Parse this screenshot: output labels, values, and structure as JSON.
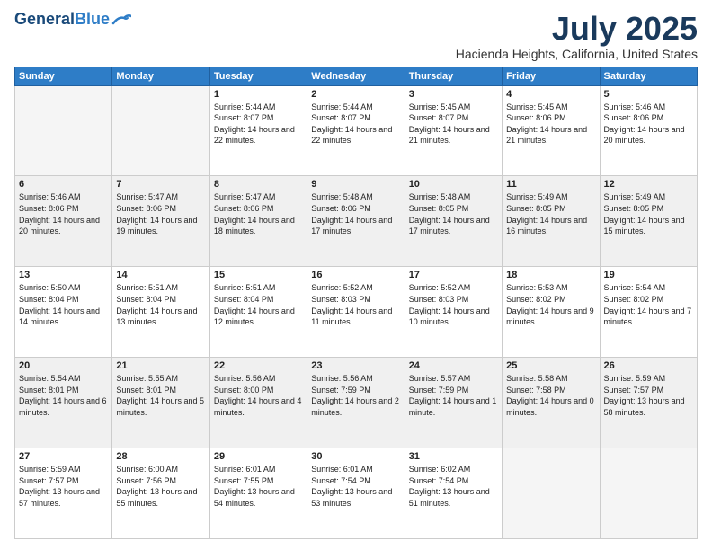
{
  "header": {
    "logo_line1": "General",
    "logo_line2": "Blue",
    "month_title": "July 2025",
    "location": "Hacienda Heights, California, United States"
  },
  "weekdays": [
    "Sunday",
    "Monday",
    "Tuesday",
    "Wednesday",
    "Thursday",
    "Friday",
    "Saturday"
  ],
  "weeks": [
    [
      {
        "day": "",
        "info": ""
      },
      {
        "day": "",
        "info": ""
      },
      {
        "day": "1",
        "info": "Sunrise: 5:44 AM\nSunset: 8:07 PM\nDaylight: 14 hours and 22 minutes."
      },
      {
        "day": "2",
        "info": "Sunrise: 5:44 AM\nSunset: 8:07 PM\nDaylight: 14 hours and 22 minutes."
      },
      {
        "day": "3",
        "info": "Sunrise: 5:45 AM\nSunset: 8:07 PM\nDaylight: 14 hours and 21 minutes."
      },
      {
        "day": "4",
        "info": "Sunrise: 5:45 AM\nSunset: 8:06 PM\nDaylight: 14 hours and 21 minutes."
      },
      {
        "day": "5",
        "info": "Sunrise: 5:46 AM\nSunset: 8:06 PM\nDaylight: 14 hours and 20 minutes."
      }
    ],
    [
      {
        "day": "6",
        "info": "Sunrise: 5:46 AM\nSunset: 8:06 PM\nDaylight: 14 hours and 20 minutes."
      },
      {
        "day": "7",
        "info": "Sunrise: 5:47 AM\nSunset: 8:06 PM\nDaylight: 14 hours and 19 minutes."
      },
      {
        "day": "8",
        "info": "Sunrise: 5:47 AM\nSunset: 8:06 PM\nDaylight: 14 hours and 18 minutes."
      },
      {
        "day": "9",
        "info": "Sunrise: 5:48 AM\nSunset: 8:06 PM\nDaylight: 14 hours and 17 minutes."
      },
      {
        "day": "10",
        "info": "Sunrise: 5:48 AM\nSunset: 8:05 PM\nDaylight: 14 hours and 17 minutes."
      },
      {
        "day": "11",
        "info": "Sunrise: 5:49 AM\nSunset: 8:05 PM\nDaylight: 14 hours and 16 minutes."
      },
      {
        "day": "12",
        "info": "Sunrise: 5:49 AM\nSunset: 8:05 PM\nDaylight: 14 hours and 15 minutes."
      }
    ],
    [
      {
        "day": "13",
        "info": "Sunrise: 5:50 AM\nSunset: 8:04 PM\nDaylight: 14 hours and 14 minutes."
      },
      {
        "day": "14",
        "info": "Sunrise: 5:51 AM\nSunset: 8:04 PM\nDaylight: 14 hours and 13 minutes."
      },
      {
        "day": "15",
        "info": "Sunrise: 5:51 AM\nSunset: 8:04 PM\nDaylight: 14 hours and 12 minutes."
      },
      {
        "day": "16",
        "info": "Sunrise: 5:52 AM\nSunset: 8:03 PM\nDaylight: 14 hours and 11 minutes."
      },
      {
        "day": "17",
        "info": "Sunrise: 5:52 AM\nSunset: 8:03 PM\nDaylight: 14 hours and 10 minutes."
      },
      {
        "day": "18",
        "info": "Sunrise: 5:53 AM\nSunset: 8:02 PM\nDaylight: 14 hours and 9 minutes."
      },
      {
        "day": "19",
        "info": "Sunrise: 5:54 AM\nSunset: 8:02 PM\nDaylight: 14 hours and 7 minutes."
      }
    ],
    [
      {
        "day": "20",
        "info": "Sunrise: 5:54 AM\nSunset: 8:01 PM\nDaylight: 14 hours and 6 minutes."
      },
      {
        "day": "21",
        "info": "Sunrise: 5:55 AM\nSunset: 8:01 PM\nDaylight: 14 hours and 5 minutes."
      },
      {
        "day": "22",
        "info": "Sunrise: 5:56 AM\nSunset: 8:00 PM\nDaylight: 14 hours and 4 minutes."
      },
      {
        "day": "23",
        "info": "Sunrise: 5:56 AM\nSunset: 7:59 PM\nDaylight: 14 hours and 2 minutes."
      },
      {
        "day": "24",
        "info": "Sunrise: 5:57 AM\nSunset: 7:59 PM\nDaylight: 14 hours and 1 minute."
      },
      {
        "day": "25",
        "info": "Sunrise: 5:58 AM\nSunset: 7:58 PM\nDaylight: 14 hours and 0 minutes."
      },
      {
        "day": "26",
        "info": "Sunrise: 5:59 AM\nSunset: 7:57 PM\nDaylight: 13 hours and 58 minutes."
      }
    ],
    [
      {
        "day": "27",
        "info": "Sunrise: 5:59 AM\nSunset: 7:57 PM\nDaylight: 13 hours and 57 minutes."
      },
      {
        "day": "28",
        "info": "Sunrise: 6:00 AM\nSunset: 7:56 PM\nDaylight: 13 hours and 55 minutes."
      },
      {
        "day": "29",
        "info": "Sunrise: 6:01 AM\nSunset: 7:55 PM\nDaylight: 13 hours and 54 minutes."
      },
      {
        "day": "30",
        "info": "Sunrise: 6:01 AM\nSunset: 7:54 PM\nDaylight: 13 hours and 53 minutes."
      },
      {
        "day": "31",
        "info": "Sunrise: 6:02 AM\nSunset: 7:54 PM\nDaylight: 13 hours and 51 minutes."
      },
      {
        "day": "",
        "info": ""
      },
      {
        "day": "",
        "info": ""
      }
    ]
  ]
}
